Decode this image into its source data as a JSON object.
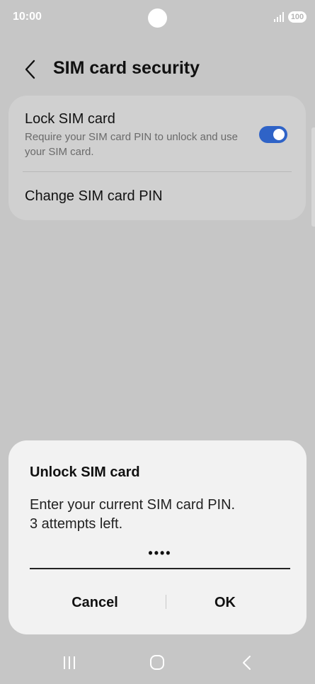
{
  "status_bar": {
    "time": "10:00",
    "battery": "100"
  },
  "header": {
    "title": "SIM card security"
  },
  "settings": {
    "lock_sim": {
      "title": "Lock SIM card",
      "description": "Require your SIM card PIN to unlock and use your SIM card.",
      "enabled": true
    },
    "change_pin": {
      "label": "Change SIM card PIN"
    }
  },
  "dialog": {
    "title": "Unlock SIM card",
    "message_line1": "Enter your current SIM card PIN.",
    "message_line2": "3 attempts left.",
    "pin_value": "••••",
    "cancel_label": "Cancel",
    "ok_label": "OK"
  },
  "colors": {
    "background": "#c6c6c6",
    "card": "#d0d0d0",
    "dialog": "#f2f2f2",
    "toggle_on": "#2f63c7"
  },
  "nav": {
    "recents_icon": "recents-icon",
    "home_icon": "home-icon",
    "back_icon": "back-icon"
  }
}
